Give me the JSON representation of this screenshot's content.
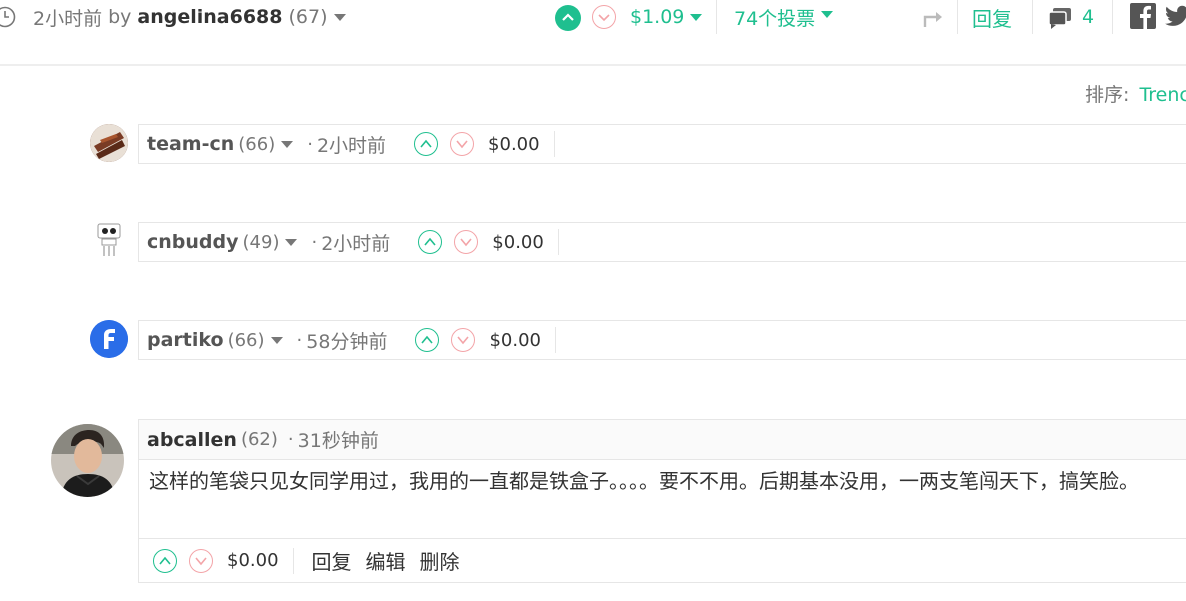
{
  "post_meta": {
    "time": "2小时前",
    "by": "by",
    "author": "angelina6688",
    "author_rep": "(67)",
    "payout": "$1.09",
    "votes": "74个投票",
    "reply_label": "回复",
    "comment_count": "4"
  },
  "sort": {
    "label": "排序:",
    "value": "Trenc"
  },
  "comments": [
    {
      "author": "team-cn",
      "rep": "(66)",
      "dot": "·",
      "time": "2小时前",
      "payout": "$0.00"
    },
    {
      "author": "cnbuddy",
      "rep": "(49)",
      "dot": "·",
      "time": "2小时前",
      "payout": "$0.00"
    },
    {
      "author": "partiko",
      "rep": "(66)",
      "dot": "·",
      "time": "58分钟前",
      "payout": "$0.00"
    }
  ],
  "expanded_comment": {
    "author": "abcallen",
    "rep": "(62)",
    "dot": "·",
    "time": "31秒钟前",
    "body": "这样的笔袋只见女同学用过，我用的一直都是铁盒子。。。。要不不用。后期基本没用，一两支笔闯天下，搞笑脸。",
    "payout": "$0.00",
    "actions": {
      "reply": "回复",
      "edit": "编辑",
      "delete": "删除"
    }
  },
  "colors": {
    "accent": "#1FBF8F",
    "downvote": "#f3a4a8"
  }
}
